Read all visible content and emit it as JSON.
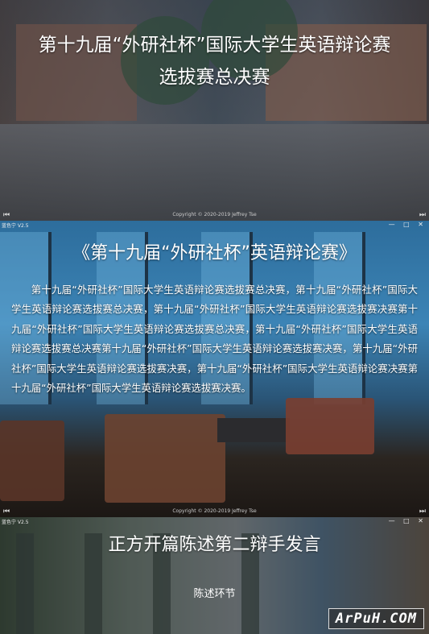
{
  "panel1": {
    "title_line1": "第十九届“外研社杯”国际大学生英语辩论赛",
    "title_line2": "选拔赛总决赛",
    "controls": {
      "prev": "⏮",
      "next": "⏭",
      "copyright": "Copyright © 2020-2019 Jeffrey Tse"
    }
  },
  "panel2": {
    "window_title": "蓝色宁 V2.5",
    "window_buttons": "— □ ✕",
    "title": "《第十九届“外研社杯”英语辩论赛》",
    "body": "第十九届“外研社杯”国际大学生英语辩论赛选拔赛总决赛，第十九届“外研社杯”国际大学生英语辩论赛选拔赛总决赛，第十九届“外研社杯”国际大学生英语辩论赛选拔赛决赛第十九届“外研社杯”国际大学生英语辩论赛选拔赛总决赛，第十九届“外研社杯”国际大学生英语辩论赛选拔赛总决赛第十九届“外研社杯”国际大学生英语辩论赛选拔赛决赛，第十九届“外研社杯”国际大学生英语辩论赛选拔赛决赛，第十九届“外研社杯”国际大学生英语辩论赛决赛第十九届“外研社杯”国际大学生英语辩论赛选拔赛决赛。",
    "controls": {
      "prev": "⏮",
      "next": "⏭",
      "copyright": "Copyright © 2020-2019 Jeffrey Tse"
    }
  },
  "panel3": {
    "window_title": "蓝色宁 V2.5",
    "window_buttons": "— □ ✕",
    "title": "正方开篇陈述第二辩手发言",
    "subtitle": "陈述环节"
  },
  "watermark": "ArPuH.COM"
}
